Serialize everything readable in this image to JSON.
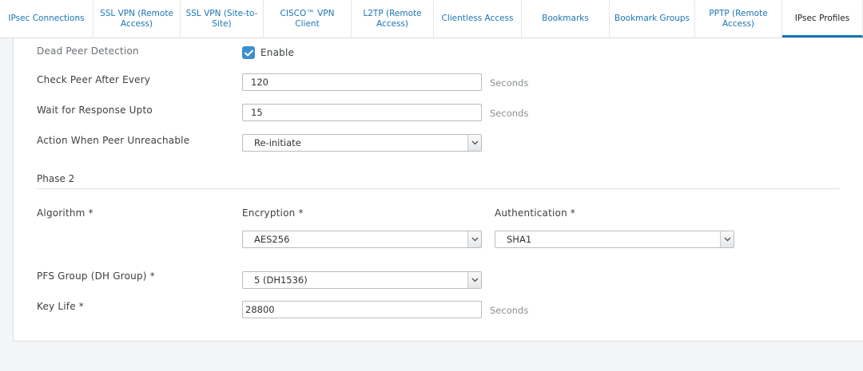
{
  "tabs": [
    {
      "label": "IPsec Connections",
      "active": false
    },
    {
      "label": "SSL VPN (Remote Access)",
      "active": false
    },
    {
      "label": "SSL VPN (Site-to-Site)",
      "active": false
    },
    {
      "label": "CISCO™ VPN Client",
      "active": false
    },
    {
      "label": "L2TP (Remote Access)",
      "active": false
    },
    {
      "label": "Clientless Access",
      "active": false
    },
    {
      "label": "Bookmarks",
      "active": false
    },
    {
      "label": "Bookmark Groups",
      "active": false
    },
    {
      "label": "PPTP (Remote Access)",
      "active": false
    },
    {
      "label": "IPsec Profiles",
      "active": true
    }
  ],
  "dpd": {
    "label": "Dead Peer Detection",
    "checkbox_label": "Enable",
    "checked": true,
    "icon": "check-icon"
  },
  "check_peer": {
    "label": "Check Peer After Every",
    "value": "120",
    "unit": "Seconds"
  },
  "wait_response": {
    "label": "Wait for Response Upto",
    "value": "15",
    "unit": "Seconds"
  },
  "action_unreachable": {
    "label": "Action When Peer Unreachable",
    "selected": "Re-initiate"
  },
  "phase2": {
    "title": "Phase 2",
    "algorithm_label": "Algorithm *",
    "encryption_label": "Encryption *",
    "encryption_selected": "AES256",
    "authentication_label": "Authentication *",
    "authentication_selected": "SHA1",
    "pfs_label": "PFS Group (DH Group) *",
    "pfs_selected": "5 (DH1536)",
    "keylife_label": "Key Life *",
    "keylife_value": "28800",
    "keylife_unit": "Seconds"
  },
  "colors": {
    "accent": "#1a75b5",
    "checkbox": "#3a8fd0"
  }
}
